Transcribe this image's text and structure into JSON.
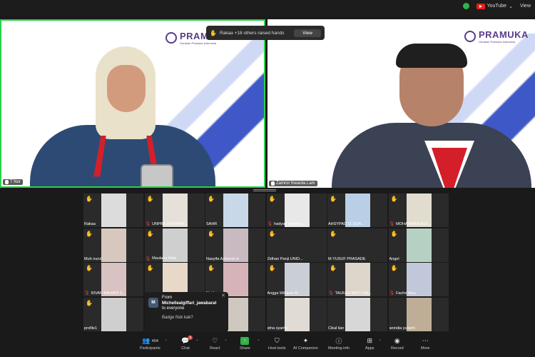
{
  "topbar": {
    "youtube_label": "YouTube",
    "view_label": "View"
  },
  "raise_hand": {
    "text": "Rakaa +18 others raised hands",
    "button": "View"
  },
  "speakers": [
    {
      "name": "T Nur"
    },
    {
      "name": "Zamror Kwarda Lam"
    }
  ],
  "banner": {
    "brand": "PRAMUKA",
    "tagline": "Gerakan Pramuka Indonesia"
  },
  "gallery": [
    {
      "name": "Rakaa",
      "hand": true,
      "muted": false,
      "color": "#dcdcdc"
    },
    {
      "name": "UNPRA SURABAY...",
      "hand": true,
      "muted": true,
      "color": "#e5e0d8"
    },
    {
      "name": "SAHR",
      "hand": true,
      "muted": false,
      "color": "#c8d8e8"
    },
    {
      "name": "hadyan adyatmu...",
      "hand": true,
      "muted": true,
      "color": "#e8e8e8"
    },
    {
      "name": "AHSYPAD 11 DUA...",
      "hand": true,
      "muted": false,
      "color": "#b9cfe6"
    },
    {
      "name": "MOHAMMAD ALF...",
      "hand": true,
      "muted": true,
      "color": "#e2dccf"
    },
    {
      "name": "Muh nurul",
      "hand": true,
      "muted": false,
      "color": "#d8c7bd"
    },
    {
      "name": "Maulana Ishiq",
      "hand": true,
      "muted": true,
      "color": "#cfcfcf"
    },
    {
      "name": "Nasyifa Azkiarah A",
      "hand": true,
      "muted": false,
      "color": "#c9b9c1"
    },
    {
      "name": "Zidhan Panji UNID...",
      "hand": true,
      "muted": false,
      "color": "#2a2a2a"
    },
    {
      "name": "M.YUSUF PRASADE",
      "hand": true,
      "muted": false,
      "color": "#2a2a2a"
    },
    {
      "name": "Angel",
      "hand": true,
      "muted": false,
      "color": "#b6d1c3"
    },
    {
      "name": "RIVAN RAHADI S...",
      "hand": true,
      "muted": true,
      "color": "#d9c2c2"
    },
    {
      "name": "",
      "hand": true,
      "muted": false,
      "color": "#e8d8c8"
    },
    {
      "name": "Najd",
      "hand": true,
      "muted": false,
      "color": "#d6b3b8"
    },
    {
      "name": "Angga Wibawa M...",
      "hand": true,
      "muted": false,
      "color": "#c9cfd4"
    },
    {
      "name": "TAUFAN BAYU SA...",
      "hand": true,
      "muted": true,
      "color": "#ddd6cb"
    },
    {
      "name": "Fachri Ibnu",
      "hand": true,
      "muted": true,
      "color": "#c1c8da"
    },
    {
      "name": "profile1",
      "hand": true,
      "muted": false,
      "color": "#cfcfcf"
    },
    {
      "name": "",
      "hand": false,
      "muted": false,
      "color": "#2a2a2a"
    },
    {
      "name": "MP 2 KLA",
      "hand": false,
      "muted": false,
      "color": "#cfc8c0"
    },
    {
      "name": "afna syarifa",
      "hand": false,
      "muted": false,
      "color": "#e0dcd5"
    },
    {
      "name": "Cikal lian",
      "hand": false,
      "muted": false,
      "color": "#d7d7d7"
    },
    {
      "name": "anindia yulianti",
      "hand": false,
      "muted": false,
      "color": "#bfae97"
    }
  ],
  "chat_toast": {
    "avatar": "M",
    "from": "From",
    "sender": "Michellealgiffari_jawabarat",
    "to": "to everyone",
    "message": "Badge fisik kak?"
  },
  "toolbar": {
    "participants_count": "404",
    "participants": "Participants",
    "chat": "Chat",
    "chat_badge": "3",
    "react": "React",
    "share": "Share",
    "host_tools": "Host tools",
    "ai_companion": "AI Companion",
    "meeting_info": "Meeting info",
    "apps": "Apps",
    "record": "Record",
    "more": "More"
  },
  "colors": {
    "active_speaker": "#2ad14a",
    "share_green": "#2fb34a",
    "hand": "#f5c518",
    "muted": "#e0453c"
  }
}
